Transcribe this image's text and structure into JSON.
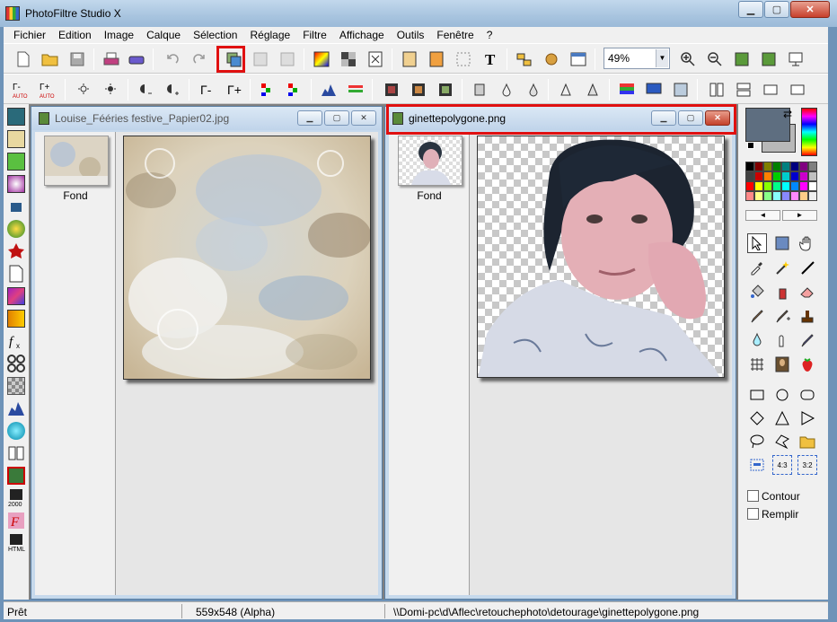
{
  "window": {
    "title": "PhotoFiltre Studio X"
  },
  "menu": [
    "Fichier",
    "Edition",
    "Image",
    "Calque",
    "Sélection",
    "Réglage",
    "Filtre",
    "Affichage",
    "Outils",
    "Fenêtre",
    "?"
  ],
  "toolbar": {
    "zoom": "49%"
  },
  "documents": [
    {
      "title": "Louise_Fééries festive_Papier02.jpg",
      "layer_label": "Fond"
    },
    {
      "title": "ginettepolygone.png",
      "layer_label": "Fond"
    }
  ],
  "right_panel": {
    "contour_label": "Contour",
    "remplir_label": "Remplir",
    "ratio_43": "4:3",
    "ratio_32": "3:2"
  },
  "status": {
    "state": "Prêt",
    "dimensions": "559x548 (Alpha)",
    "path": "\\\\Domi-pc\\d\\Aflec\\retouchephoto\\detourage\\ginettepolygone.png"
  },
  "colors": {
    "highlight": "#e01010",
    "fg_swatch": "#5e6e80",
    "bg_swatch": "#b8b8b8"
  },
  "icons": [
    "new-file-icon",
    "open-folder-icon",
    "save-icon",
    "print-icon",
    "scan-icon",
    "undo-icon",
    "redo-icon",
    "paste-layer-icon",
    "zoom-in-icon",
    "zoom-out-icon",
    "text-tool-icon",
    "pointer-icon",
    "hand-icon",
    "eyedropper-icon",
    "brush-icon",
    "eraser-icon"
  ]
}
